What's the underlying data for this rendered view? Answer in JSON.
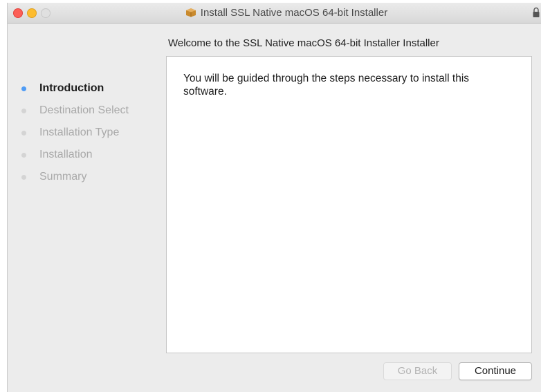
{
  "window": {
    "title": "Install SSL Native macOS 64-bit Installer",
    "title_icon": "package-icon",
    "lock_icon": "lock-icon"
  },
  "welcome": "Welcome to the SSL Native macOS 64-bit Installer Installer",
  "steps": [
    {
      "label": "Introduction",
      "active": true
    },
    {
      "label": "Destination Select",
      "active": false
    },
    {
      "label": "Installation Type",
      "active": false
    },
    {
      "label": "Installation",
      "active": false
    },
    {
      "label": "Summary",
      "active": false
    }
  ],
  "content": {
    "text": "You will be guided through the steps necessary to install this software."
  },
  "buttons": {
    "back": "Go Back",
    "continue": "Continue"
  },
  "colors": {
    "active_step_dot": "#4f9cf5",
    "close": "#fc5f57",
    "minimize": "#fdbc2e"
  }
}
